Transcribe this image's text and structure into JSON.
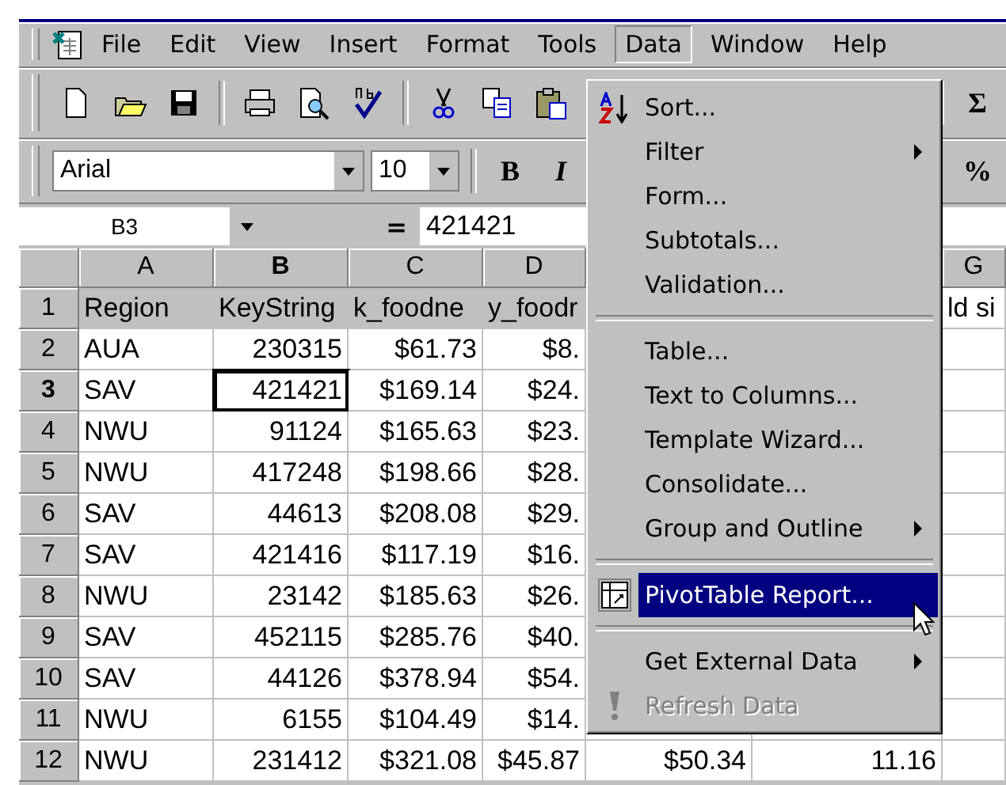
{
  "menu_bar": [
    {
      "label": "File",
      "selected": false
    },
    {
      "label": "Edit",
      "selected": false
    },
    {
      "label": "View",
      "selected": false
    },
    {
      "label": "Insert",
      "selected": false
    },
    {
      "label": "Format",
      "selected": false
    },
    {
      "label": "Tools",
      "selected": false
    },
    {
      "label": "Data",
      "selected": true
    },
    {
      "label": "Window",
      "selected": false
    },
    {
      "label": "Help",
      "selected": false
    }
  ],
  "toolbar_right": "Σ",
  "format_bar": {
    "font": "Arial",
    "size": "10",
    "bold": "B",
    "italic": "I",
    "percent": "%"
  },
  "formula_bar": {
    "name_box": "B3",
    "equals": "=",
    "value": "421421"
  },
  "columns": [
    {
      "label": "A",
      "selected": false,
      "gap_before": false
    },
    {
      "label": "B",
      "selected": true,
      "gap_before": false
    },
    {
      "label": "C",
      "selected": false,
      "gap_before": false
    },
    {
      "label": "D",
      "selected": false,
      "gap_before": false
    },
    {
      "label": "G",
      "selected": false,
      "gap_before": true
    }
  ],
  "rows": [
    {
      "number": "1",
      "selected": false,
      "cells": [
        "Region",
        "KeyString",
        "k_foodne",
        "y_foodr",
        null,
        null,
        "ld si"
      ]
    },
    {
      "number": "2",
      "selected": false,
      "cells": [
        "AUA",
        "230315",
        "$61.73",
        "$8."
      ]
    },
    {
      "number": "3",
      "selected": true,
      "cells": [
        "SAV",
        "421421",
        "$169.14",
        "$24."
      ]
    },
    {
      "number": "4",
      "selected": false,
      "cells": [
        "NWU",
        "91124",
        "$165.63",
        "$23."
      ]
    },
    {
      "number": "5",
      "selected": false,
      "cells": [
        "NWU",
        "417248",
        "$198.66",
        "$28."
      ]
    },
    {
      "number": "6",
      "selected": false,
      "cells": [
        "SAV",
        "44613",
        "$208.08",
        "$29."
      ]
    },
    {
      "number": "7",
      "selected": false,
      "cells": [
        "SAV",
        "421416",
        "$117.19",
        "$16."
      ]
    },
    {
      "number": "8",
      "selected": false,
      "cells": [
        "NWU",
        "23142",
        "$185.63",
        "$26."
      ]
    },
    {
      "number": "9",
      "selected": false,
      "cells": [
        "SAV",
        "452115",
        "$285.76",
        "$40."
      ]
    },
    {
      "number": "10",
      "selected": false,
      "cells": [
        "SAV",
        "44126",
        "$378.94",
        "$54."
      ]
    },
    {
      "number": "11",
      "selected": false,
      "cells": [
        "NWU",
        "6155",
        "$104.49",
        "$14."
      ]
    },
    {
      "number": "12",
      "selected": false,
      "cells": [
        "NWU",
        "231412",
        "$321.08",
        "$45.87",
        "$50.34",
        "11.16"
      ]
    }
  ],
  "data_menu": [
    {
      "kind": "item",
      "label": "Sort...",
      "submenu": false,
      "selected": false,
      "disabled": false
    },
    {
      "kind": "item",
      "label": "Filter",
      "submenu": true,
      "selected": false,
      "disabled": false
    },
    {
      "kind": "item",
      "label": "Form...",
      "submenu": false,
      "selected": false,
      "disabled": false
    },
    {
      "kind": "item",
      "label": "Subtotals...",
      "submenu": false,
      "selected": false,
      "disabled": false
    },
    {
      "kind": "item",
      "label": "Validation...",
      "submenu": false,
      "selected": false,
      "disabled": false
    },
    {
      "kind": "separator"
    },
    {
      "kind": "item",
      "label": "Table...",
      "submenu": false,
      "selected": false,
      "disabled": false
    },
    {
      "kind": "item",
      "label": "Text to Columns...",
      "submenu": false,
      "selected": false,
      "disabled": false
    },
    {
      "kind": "item",
      "label": "Template Wizard...",
      "submenu": false,
      "selected": false,
      "disabled": false
    },
    {
      "kind": "item",
      "label": "Consolidate...",
      "submenu": false,
      "selected": false,
      "disabled": false
    },
    {
      "kind": "item",
      "label": "Group and Outline",
      "submenu": true,
      "selected": false,
      "disabled": false
    },
    {
      "kind": "separator"
    },
    {
      "kind": "item",
      "label": "PivotTable Report...",
      "submenu": false,
      "selected": true,
      "disabled": false
    },
    {
      "kind": "separator"
    },
    {
      "kind": "item",
      "label": "Get External Data",
      "submenu": true,
      "selected": false,
      "disabled": false
    },
    {
      "kind": "item",
      "label": "Refresh Data",
      "submenu": false,
      "selected": false,
      "disabled": true
    }
  ]
}
